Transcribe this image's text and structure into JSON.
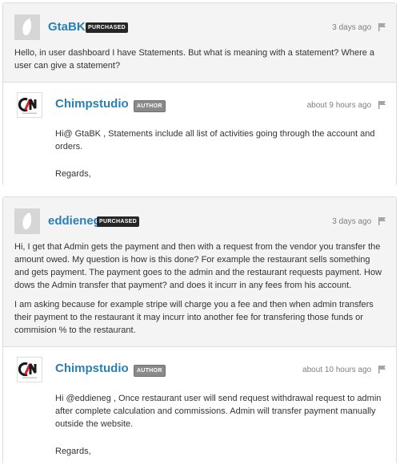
{
  "threads": [
    {
      "question": {
        "username": "GtaBK",
        "badge": "PURCHASED",
        "time": "3 days ago",
        "paragraphs": [
          "Hello, in user dashboard I have Statements. But what is meaning with a statement? Where a user can give a statement?"
        ]
      },
      "reply": {
        "username": "Chimpstudio",
        "badge": "AUTHOR",
        "time": "about 9 hours ago",
        "paragraphs": [
          "Hi@ GtaBK , Statements include all list of activities going through the account and orders.",
          "Regards,"
        ]
      }
    },
    {
      "question": {
        "username": "eddieneg",
        "badge": "PURCHASED",
        "time": "3 days ago",
        "paragraphs": [
          "Hi, I get that Admin gets the payment and then with a request from the vendor you transfer the amount owed. My question is how is this done? For example the restaurant sells something and gets payment. The payment goes to the admin and the restaurant requests payment. How dows the Admin transfer that payment? and does it incurr in any fees from his account.",
          "I am asking because for example stripe will charge you a fee and then when admin transfers their payment to the restaurant it may incurr into another fee for transfering those funds or commision % to the restaurant."
        ]
      },
      "reply": {
        "username": "Chimpstudio",
        "badge": "AUTHOR",
        "time": "about 10 hours ago",
        "paragraphs": [
          "Hi @eddieneg , Once restaurant user will send request withdrawal request to admin after complete calculation and commissions. Admin will transfer payment manually outside the website.",
          "Regards,"
        ]
      }
    }
  ],
  "colors": {
    "username": "#2980b9",
    "purchased_badge": "#262626",
    "author_badge": "#8a8a8a",
    "logo_red": "#d81f26",
    "logo_dark": "#1a1a1a"
  }
}
